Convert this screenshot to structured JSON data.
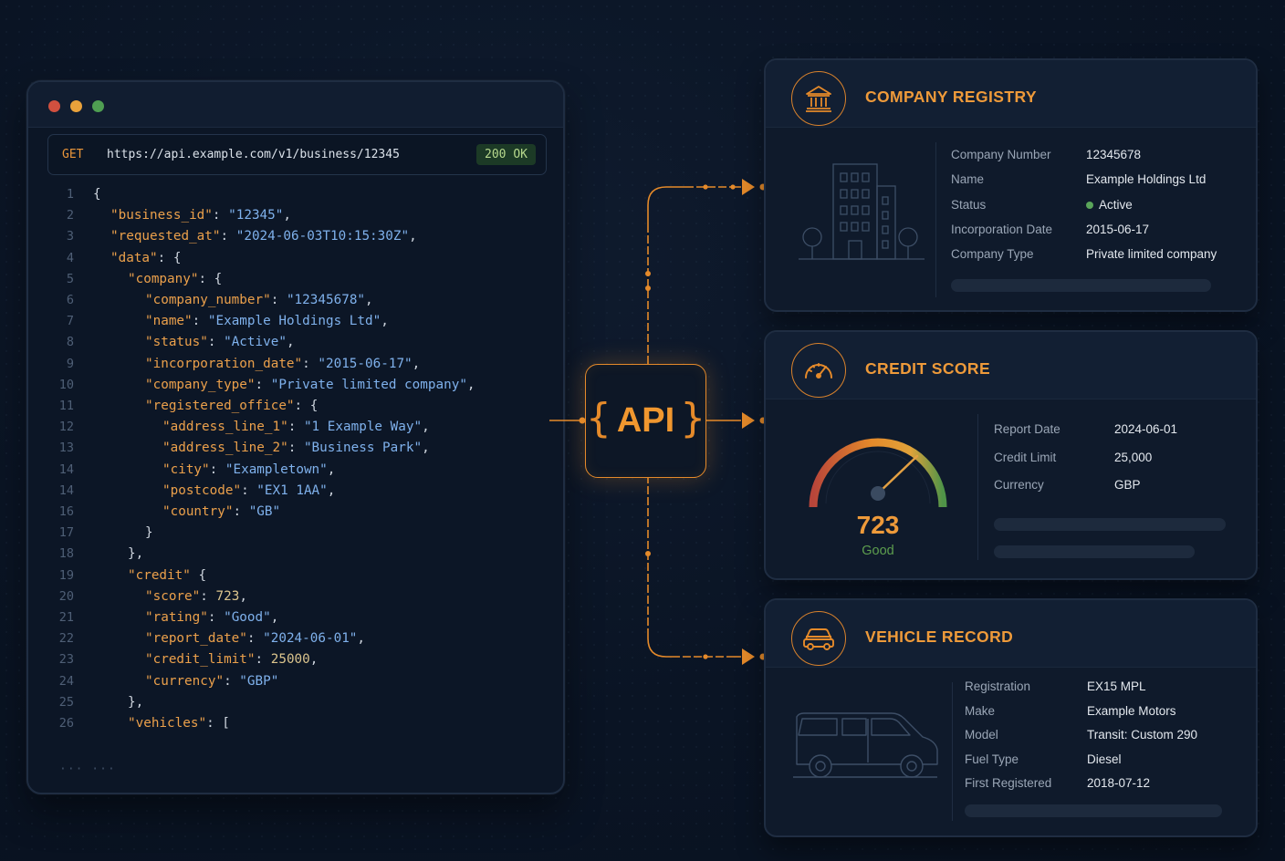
{
  "request": {
    "method": "GET",
    "url": "https://api.example.com/v1/business/12345",
    "status": "200 OK"
  },
  "code_lines": [
    {
      "n": "1",
      "indent": 0,
      "parts": [
        [
          "p",
          "{"
        ]
      ]
    },
    {
      "n": "2",
      "indent": 1,
      "parts": [
        [
          "k",
          "\"business_id\""
        ],
        [
          "p",
          ": "
        ],
        [
          "s",
          "\"12345\""
        ],
        [
          "p",
          ","
        ]
      ]
    },
    {
      "n": "3",
      "indent": 1,
      "parts": [
        [
          "k",
          "\"requested_at\""
        ],
        [
          "p",
          ": "
        ],
        [
          "s",
          "\"2024-06-03T10:15:30Z\""
        ],
        [
          "p",
          ","
        ]
      ]
    },
    {
      "n": "4",
      "indent": 1,
      "parts": [
        [
          "k",
          "\"data\""
        ],
        [
          "p",
          ": {"
        ]
      ]
    },
    {
      "n": "5",
      "indent": 2,
      "parts": [
        [
          "k",
          "\"company\""
        ],
        [
          "p",
          ": {"
        ]
      ]
    },
    {
      "n": "6",
      "indent": 3,
      "parts": [
        [
          "k",
          "\"company_number\""
        ],
        [
          "p",
          ": "
        ],
        [
          "s",
          "\"12345678\""
        ],
        [
          "p",
          ","
        ]
      ]
    },
    {
      "n": "7",
      "indent": 3,
      "parts": [
        [
          "k",
          "\"name\""
        ],
        [
          "p",
          ": "
        ],
        [
          "s",
          "\"Example Holdings Ltd\""
        ],
        [
          "p",
          ","
        ]
      ]
    },
    {
      "n": "8",
      "indent": 3,
      "parts": [
        [
          "k",
          "\"status\""
        ],
        [
          "p",
          ": "
        ],
        [
          "s",
          "\"Active\""
        ],
        [
          "p",
          ","
        ]
      ]
    },
    {
      "n": "9",
      "indent": 3,
      "parts": [
        [
          "k",
          "\"incorporation_date\""
        ],
        [
          "p",
          ": "
        ],
        [
          "s",
          "\"2015-06-17\""
        ],
        [
          "p",
          ","
        ]
      ]
    },
    {
      "n": "10",
      "indent": 3,
      "parts": [
        [
          "k",
          "\"company_type\""
        ],
        [
          "p",
          ": "
        ],
        [
          "s",
          "\"Private limited company\""
        ],
        [
          "p",
          ","
        ]
      ]
    },
    {
      "n": "11",
      "indent": 3,
      "parts": [
        [
          "k",
          "\"registered_office\""
        ],
        [
          "p",
          ": {"
        ]
      ]
    },
    {
      "n": "12",
      "indent": 4,
      "parts": [
        [
          "k",
          "\"address_line_1\""
        ],
        [
          "p",
          ": "
        ],
        [
          "s",
          "\"1 Example Way\""
        ],
        [
          "p",
          ","
        ]
      ]
    },
    {
      "n": "13",
      "indent": 4,
      "parts": [
        [
          "k",
          "\"address_line_2\""
        ],
        [
          "p",
          ": "
        ],
        [
          "s",
          "\"Business Park\""
        ],
        [
          "p",
          ","
        ]
      ]
    },
    {
      "n": "14",
      "indent": 4,
      "parts": [
        [
          "k",
          "\"city\""
        ],
        [
          "p",
          ": "
        ],
        [
          "s",
          "\"Exampletown\""
        ],
        [
          "p",
          ","
        ]
      ]
    },
    {
      "n": "14",
      "indent": 4,
      "parts": [
        [
          "k",
          "\"postcode\""
        ],
        [
          "p",
          ": "
        ],
        [
          "s",
          "\"EX1 1AA\""
        ],
        [
          "p",
          ","
        ]
      ]
    },
    {
      "n": "16",
      "indent": 4,
      "parts": [
        [
          "k",
          "\"country\""
        ],
        [
          "p",
          ": "
        ],
        [
          "s",
          "\"GB\""
        ]
      ]
    },
    {
      "n": "17",
      "indent": 3,
      "parts": [
        [
          "p",
          "}"
        ]
      ]
    },
    {
      "n": "18",
      "indent": 2,
      "parts": [
        [
          "p",
          "},"
        ]
      ]
    },
    {
      "n": "19",
      "indent": 2,
      "parts": [
        [
          "k",
          "\"credit\""
        ],
        [
          "p",
          " {"
        ]
      ]
    },
    {
      "n": "20",
      "indent": 3,
      "parts": [
        [
          "k",
          "\"score\""
        ],
        [
          "p",
          ": "
        ],
        [
          "n",
          "723"
        ],
        [
          "p",
          ","
        ]
      ]
    },
    {
      "n": "21",
      "indent": 3,
      "parts": [
        [
          "k",
          "\"rating\""
        ],
        [
          "p",
          ": "
        ],
        [
          "s",
          "\"Good\""
        ],
        [
          "p",
          ","
        ]
      ]
    },
    {
      "n": "22",
      "indent": 3,
      "parts": [
        [
          "k",
          "\"report_date\""
        ],
        [
          "p",
          ": "
        ],
        [
          "s",
          "\"2024-06-01\""
        ],
        [
          "p",
          ","
        ]
      ]
    },
    {
      "n": "23",
      "indent": 3,
      "parts": [
        [
          "k",
          "\"credit_limit\""
        ],
        [
          "p",
          ": "
        ],
        [
          "n",
          "25000"
        ],
        [
          "p",
          ","
        ]
      ]
    },
    {
      "n": "24",
      "indent": 3,
      "parts": [
        [
          "k",
          "\"currency\""
        ],
        [
          "p",
          ": "
        ],
        [
          "s",
          "\"GBP\""
        ]
      ]
    },
    {
      "n": "25",
      "indent": 2,
      "parts": [
        [
          "p",
          "},"
        ]
      ]
    },
    {
      "n": "26",
      "indent": 2,
      "parts": [
        [
          "k",
          "\"vehicles\""
        ],
        [
          "p",
          ": ["
        ]
      ]
    }
  ],
  "code_ellipsis": "···  ···",
  "api_label": "API",
  "api_braces": {
    "open": "{",
    "close": "}"
  },
  "company": {
    "title": "COMPANY REGISTRY",
    "icon": "bank-icon",
    "illustration": "office-building-icon",
    "fields": [
      {
        "label": "Company Number",
        "value": "12345678"
      },
      {
        "label": "Name",
        "value": "Example Holdings Ltd"
      },
      {
        "label": "Status",
        "value": "Active"
      },
      {
        "label": "Incorporation Date",
        "value": "2015-06-17"
      },
      {
        "label": "Company Type",
        "value": "Private limited company"
      }
    ]
  },
  "credit": {
    "title": "CREDIT SCORE",
    "icon": "speedometer-icon",
    "score": "723",
    "rating": "Good",
    "fields": [
      {
        "label": "Report Date",
        "value": "2024-06-01"
      },
      {
        "label": "Credit Limit",
        "value": "25,000"
      },
      {
        "label": "Currency",
        "value": "GBP"
      }
    ]
  },
  "vehicle": {
    "title": "VEHICLE RECORD",
    "icon": "car-icon",
    "illustration": "van-icon",
    "fields": [
      {
        "label": "Registration",
        "value": "EX15 MPL"
      },
      {
        "label": "Make",
        "value": "Example Motors"
      },
      {
        "label": "Model",
        "value": "Transit: Custom 290"
      },
      {
        "label": "Fuel Type",
        "value": "Diesel"
      },
      {
        "label": "First Registered",
        "value": "2018-07-12"
      }
    ]
  },
  "colors": {
    "accent": "#e58a2a",
    "key": "#eba04b",
    "string": "#7fb1ec",
    "active": "#5aa55a"
  }
}
